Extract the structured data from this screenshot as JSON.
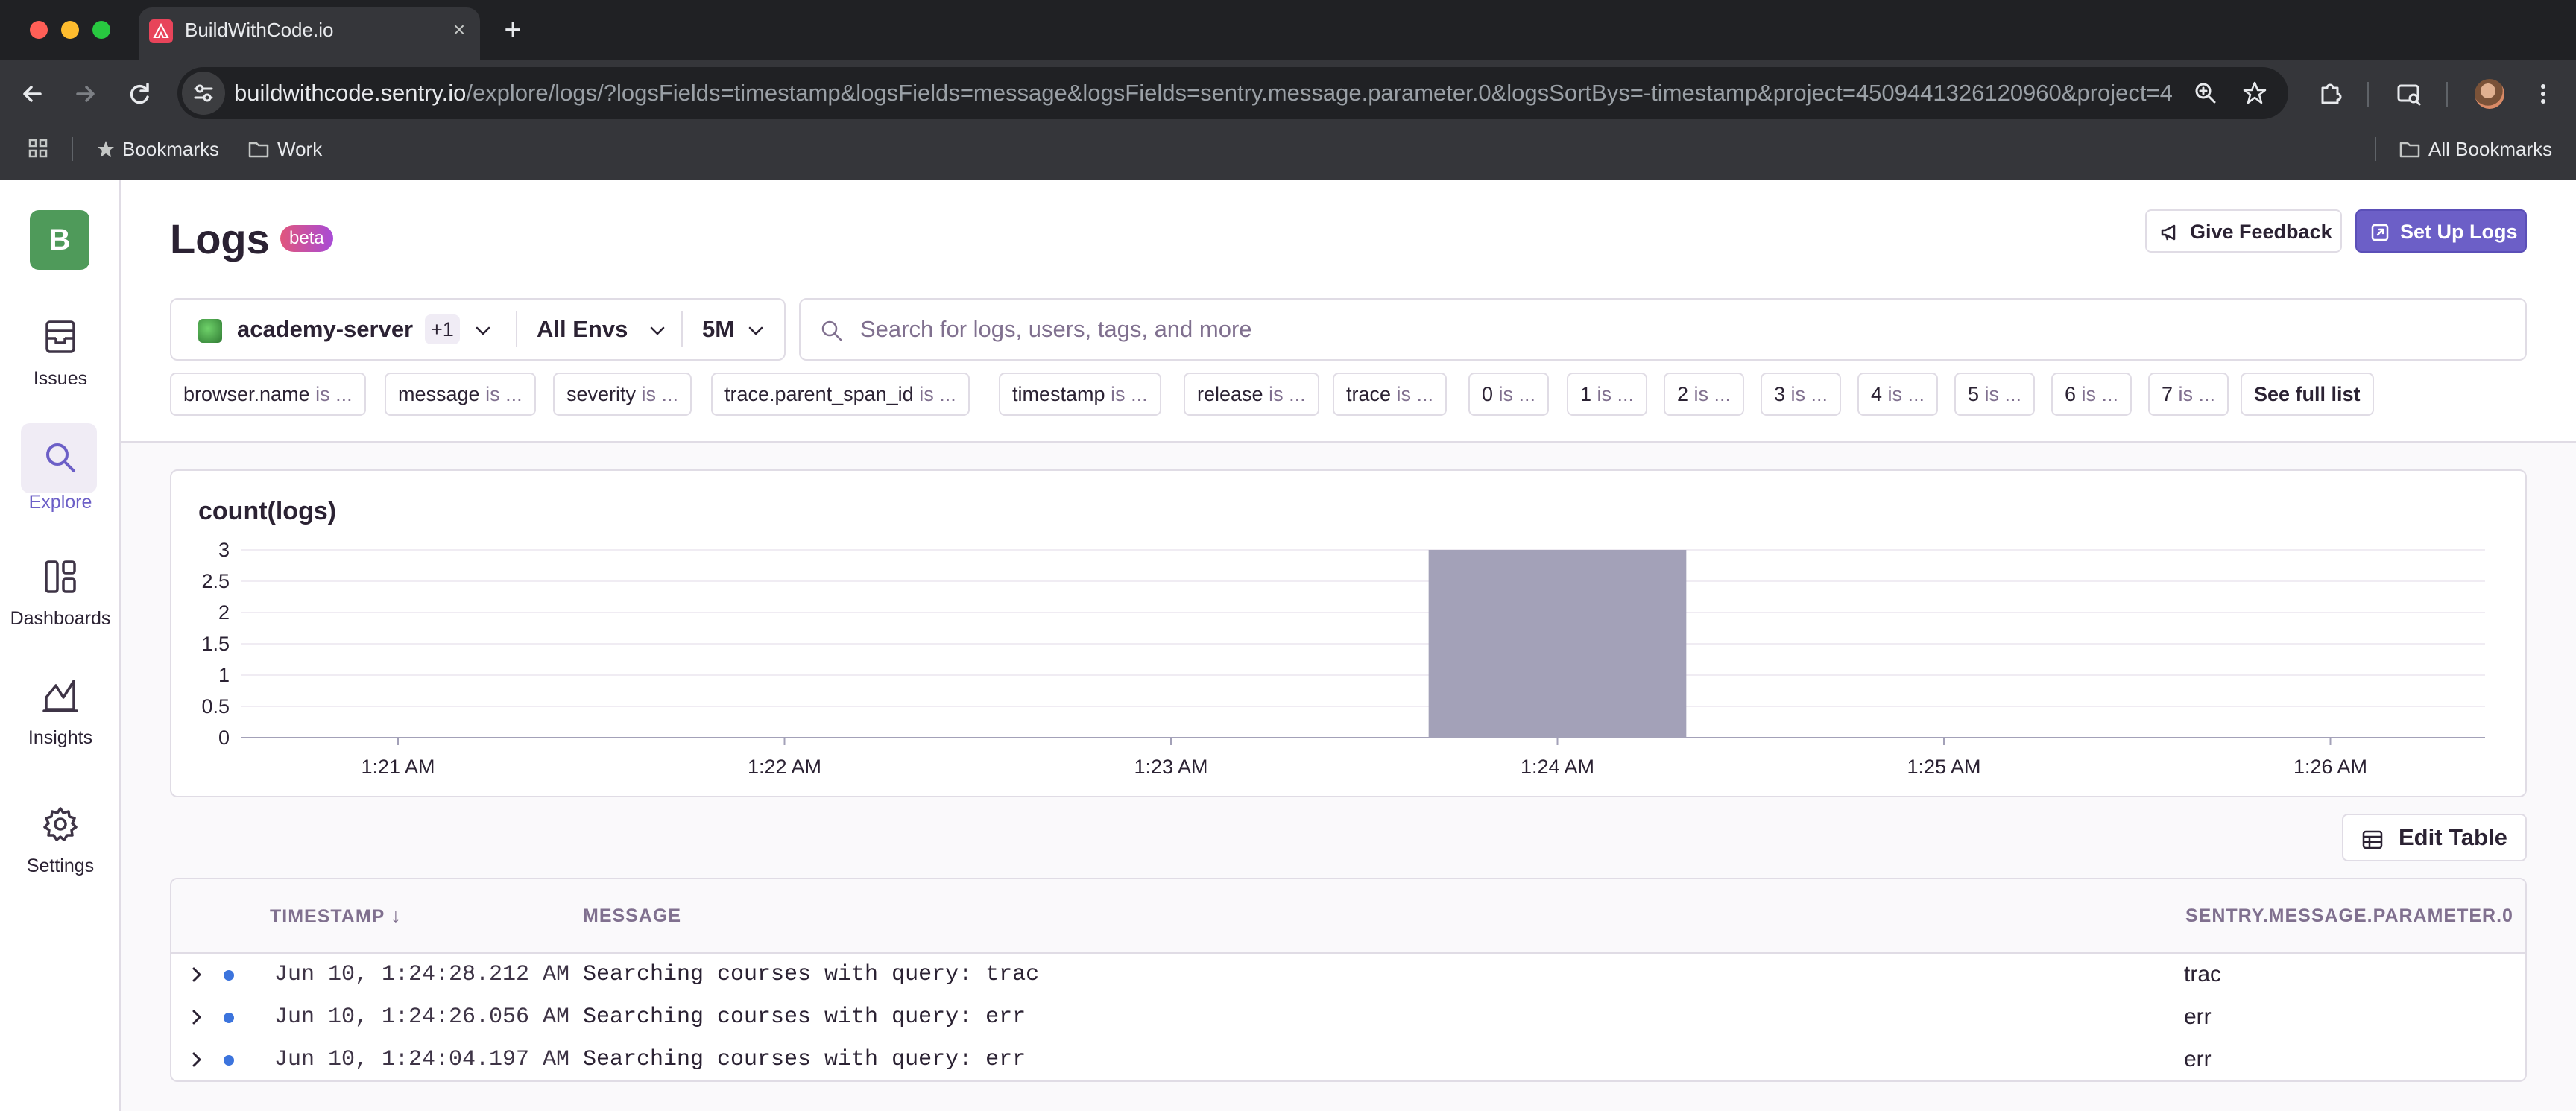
{
  "browser": {
    "tab_title": "BuildWithCode.io",
    "url_host": "buildwithcode.sentry.io",
    "url_path": "/explore/logs/?logsFields=timestamp&logsFields=message&logsFields=sentry.message.parameter.0&logsSortBys=-timestamp&project=4509441326120960&project=450...",
    "bookmarks": [
      {
        "label": "Bookmarks",
        "icon": "star-icon"
      },
      {
        "label": "Work",
        "icon": "folder-icon"
      }
    ],
    "all_bookmarks": "All Bookmarks"
  },
  "sidebar": {
    "org_initial": "B",
    "items": [
      {
        "label": "Issues",
        "icon": "issues-icon"
      },
      {
        "label": "Explore",
        "icon": "search-icon",
        "active": true
      },
      {
        "label": "Dashboards",
        "icon": "dashboards-icon"
      },
      {
        "label": "Insights",
        "icon": "insights-icon"
      },
      {
        "label": "Settings",
        "icon": "gear-icon"
      }
    ]
  },
  "header": {
    "title": "Logs",
    "badge": "beta",
    "feedback_label": "Give Feedback",
    "setup_label": "Set Up Logs"
  },
  "filters": {
    "project": "academy-server",
    "project_extra": "+1",
    "env": "All Envs",
    "period": "5M",
    "search_placeholder": "Search for logs, users, tags, and more"
  },
  "chips": [
    {
      "key": "browser.name",
      "op": "is ..."
    },
    {
      "key": "message",
      "op": "is ..."
    },
    {
      "key": "severity",
      "op": "is ..."
    },
    {
      "key": "trace.parent_span_id",
      "op": "is ..."
    },
    {
      "key": "timestamp",
      "op": "is ..."
    },
    {
      "key": "release",
      "op": "is ..."
    },
    {
      "key": "trace",
      "op": "is ..."
    },
    {
      "key": "0",
      "op": "is ..."
    },
    {
      "key": "1",
      "op": "is ..."
    },
    {
      "key": "2",
      "op": "is ..."
    },
    {
      "key": "3",
      "op": "is ..."
    },
    {
      "key": "4",
      "op": "is ..."
    },
    {
      "key": "5",
      "op": "is ..."
    },
    {
      "key": "6",
      "op": "is ..."
    },
    {
      "key": "7",
      "op": "is ..."
    }
  ],
  "see_full_list": "See full list",
  "chart_data": {
    "type": "bar",
    "title": "count(logs)",
    "x_ticks": [
      "1:21 AM",
      "1:22 AM",
      "1:23 AM",
      "1:24 AM",
      "1:25 AM",
      "1:26 AM"
    ],
    "y_ticks": [
      "3",
      "2.5",
      "2",
      "1.5",
      "1",
      "0.5",
      "0"
    ],
    "ylim": [
      0,
      3
    ],
    "bars": [
      {
        "start": "1:23:40 AM",
        "end": "1:24:20 AM",
        "value": 3
      }
    ],
    "bar_color": "#a3a1b8",
    "grid": true
  },
  "edit_table_label": "Edit Table",
  "table": {
    "columns": [
      "TIMESTAMP",
      "MESSAGE",
      "SENTRY.MESSAGE.PARAMETER.0"
    ],
    "sort_indicator": "↓",
    "rows": [
      {
        "timestamp": "Jun 10, 1:24:28.212 AM",
        "message": "Searching courses with query: trac",
        "param0": "trac"
      },
      {
        "timestamp": "Jun 10, 1:24:26.056 AM",
        "message": "Searching courses with query: err",
        "param0": "err"
      },
      {
        "timestamp": "Jun 10, 1:24:04.197 AM",
        "message": "Searching courses with query: err",
        "param0": "err"
      }
    ],
    "severity_color": "#3c74dd"
  }
}
